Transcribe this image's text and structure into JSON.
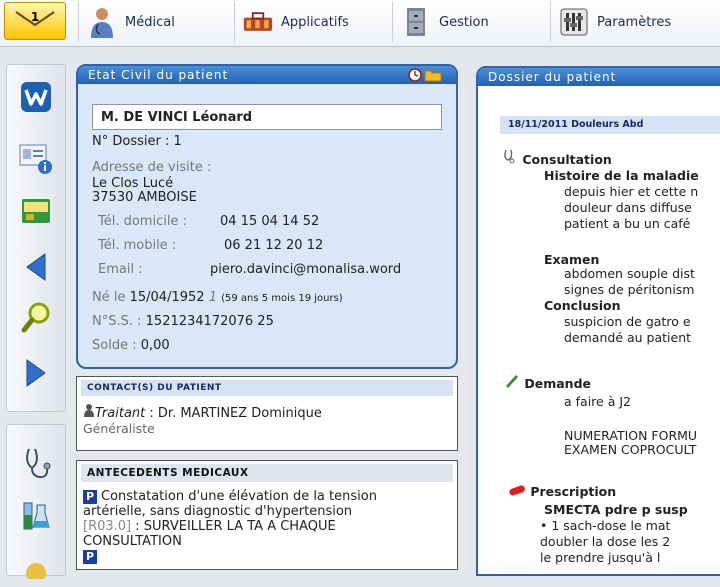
{
  "topbar": {
    "mail_count": "1",
    "menus": [
      {
        "label": "Médical"
      },
      {
        "label": "Applicatifs"
      },
      {
        "label": "Gestion"
      },
      {
        "label": "Paramètres"
      }
    ]
  },
  "etat_civil": {
    "title": "Etat Civil du patient",
    "name": "M. DE VINCI Léonard",
    "dossier": "N° Dossier : 1",
    "adresse_label": "Adresse de visite :",
    "adresse_l1": "Le Clos Lucé",
    "adresse_l2": "37530 AMBOISE",
    "tel_dom_label": "Tél. domicile :",
    "tel_dom": "04 15 04 14 52",
    "tel_mob_label": "Tél. mobile :",
    "tel_mob": "06 21 12 20 12",
    "email_label": "Email :",
    "email": "piero.davinci@monalisa.word",
    "ne_label": "Né le",
    "ne_date": "15/04/1952",
    "ne_num": "1",
    "age": "(59 ans 5 mois 19 jours)",
    "nss_label": "N°S.S. :",
    "nss": "1521234172076 25",
    "solde_label": "Solde :",
    "solde": "0,00"
  },
  "contacts": {
    "title": "Contact(s) du patient",
    "traitant_label": "Traitant",
    "traitant_value": ": Dr. MARTINEZ Dominique",
    "specialite": "Généraliste"
  },
  "antecedents": {
    "title": "ANTECEDENTS MEDICAUX",
    "item_l1": "Constatation d'une élévation de la tension",
    "item_l2": "artérielle, sans diagnostic d'hypertension",
    "code": "[R03.0]",
    "note_l1": ": SURVEILLER LA TA A CHAQUE",
    "note_l2": "CONSULTATION"
  },
  "dossier": {
    "title": "Dossier du patient",
    "date_title": "18/11/2011 Douleurs Abd",
    "consultation": "Consultation",
    "histoire": "Histoire de la maladie",
    "h1": "depuis hier et cette n",
    "h2": "douleur dans diffuse",
    "h3": "patient a bu un café",
    "examen": "Examen",
    "e1": "abdomen souple dist",
    "e2": "signes de péritonism",
    "conclusion": "Conclusion",
    "c1": "suspicion de gatro e",
    "c2": "demandé au patient",
    "demande": "Demande",
    "d1": "a faire à J2",
    "d2": "NUMERATION FORMU",
    "d3": "EXAMEN COPROCULT",
    "prescription": "Prescription",
    "p_title": "SMECTA pdre p susp",
    "p1": "• 1 sach-dose le mat",
    "p2": "doubler la dose les 2",
    "p3": "le prendre jusqu'à l"
  },
  "colors": {
    "accent": "#2c63b2",
    "panel_bg": "#d9e7f8",
    "mail": "#ffc400"
  }
}
